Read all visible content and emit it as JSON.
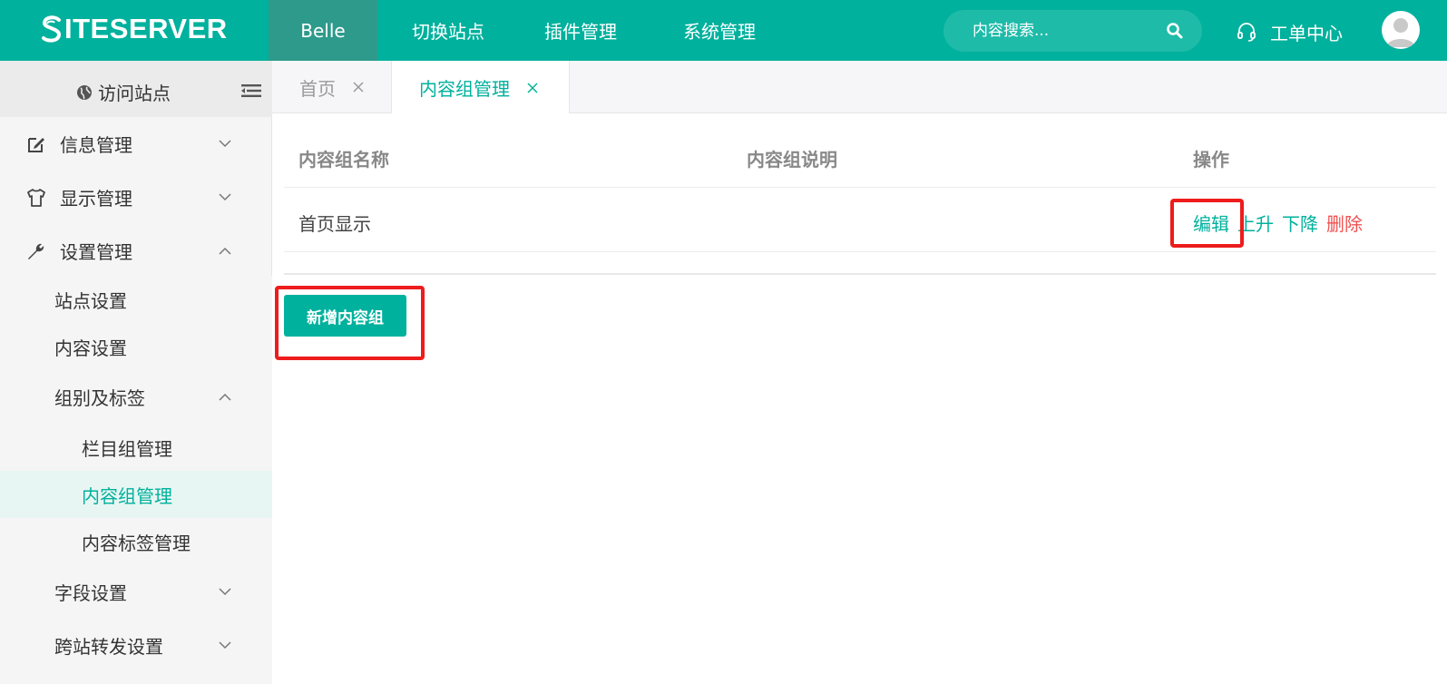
{
  "header": {
    "logo_text": "ITESERVER",
    "nav": [
      {
        "label": "Belle",
        "active": true
      },
      {
        "label": "切换站点"
      },
      {
        "label": "插件管理"
      },
      {
        "label": "系统管理"
      }
    ],
    "search_placeholder": "内容搜索...",
    "work_order_label": "工单中心",
    "brand_color": "#00b19d"
  },
  "sidebar": {
    "visit_label": "访问站点",
    "menu": [
      {
        "label": "信息管理",
        "icon": "edit-icon",
        "expanded": false
      },
      {
        "label": "显示管理",
        "icon": "tshirt-icon",
        "expanded": false
      },
      {
        "label": "设置管理",
        "icon": "wrench-icon",
        "expanded": true
      }
    ],
    "submenu": [
      {
        "label": "站点设置"
      },
      {
        "label": "内容设置"
      },
      {
        "label": "组别及标签",
        "expanded": true
      },
      {
        "label": "栏目组管理"
      },
      {
        "label": "内容组管理",
        "active": true
      },
      {
        "label": "内容标签管理"
      },
      {
        "label": "字段设置",
        "expanded": false
      },
      {
        "label": "跨站转发设置",
        "expanded": false
      }
    ]
  },
  "tabs": [
    {
      "label": "首页"
    },
    {
      "label": "内容组管理",
      "active": true
    }
  ],
  "table": {
    "headers": [
      "内容组名称",
      "内容组说明",
      "操作"
    ],
    "rows": [
      {
        "name": "首页显示",
        "description": "",
        "actions": {
          "edit": "编辑",
          "up": "上升",
          "down": "下降",
          "delete": "删除"
        }
      }
    ]
  },
  "add_button_label": "新增内容组",
  "accent_red": "#f05050"
}
